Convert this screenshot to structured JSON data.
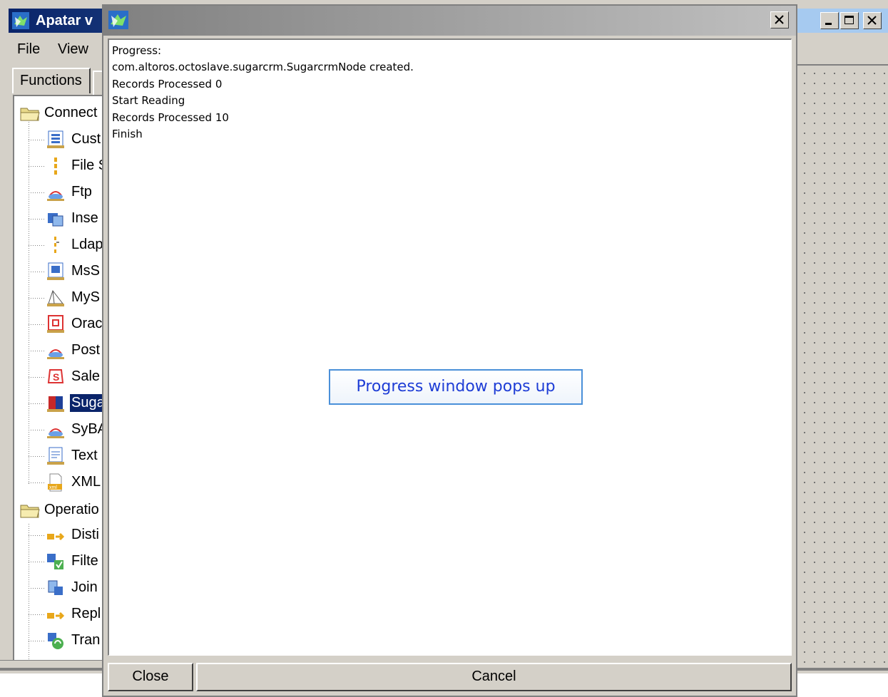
{
  "main_window": {
    "title": "Apatar v",
    "menu": [
      "File",
      "View"
    ],
    "tabs": [
      "Functions"
    ]
  },
  "tree": {
    "groups": [
      {
        "label": "Connect",
        "items": [
          {
            "label": "Cust",
            "icon": "custom-connector-icon"
          },
          {
            "label": "File S",
            "icon": "file-icon"
          },
          {
            "label": "Ftp",
            "icon": "ftp-icon"
          },
          {
            "label": "Inse",
            "icon": "insert-icon"
          },
          {
            "label": "Ldap",
            "icon": "ldap-icon"
          },
          {
            "label": "MsS",
            "icon": "mssql-icon"
          },
          {
            "label": "MyS",
            "icon": "mysql-icon"
          },
          {
            "label": "Orac",
            "icon": "oracle-icon"
          },
          {
            "label": "Post",
            "icon": "postgres-icon"
          },
          {
            "label": "Sale",
            "icon": "salesforce-icon"
          },
          {
            "label": "Suga",
            "icon": "sugarcrm-icon",
            "selected": true
          },
          {
            "label": "SyBA",
            "icon": "sybase-icon"
          },
          {
            "label": "Text",
            "icon": "text-file-icon"
          },
          {
            "label": "XML",
            "icon": "xml-icon"
          }
        ]
      },
      {
        "label": "Operatio",
        "items": [
          {
            "label": "Disti",
            "icon": "distinct-icon"
          },
          {
            "label": "Filte",
            "icon": "filter-icon"
          },
          {
            "label": "Join",
            "icon": "join-icon"
          },
          {
            "label": "Repl",
            "icon": "replace-icon"
          },
          {
            "label": "Tran",
            "icon": "transform-icon"
          }
        ]
      }
    ]
  },
  "dialog": {
    "log_lines": [
      "Progress:",
      "com.altoros.octoslave.sugarcrm.SugarcrmNode created.",
      "Records Processed 0",
      "Start Reading",
      "Records Processed 10",
      "Finish"
    ],
    "annotation": "Progress window pops up",
    "close_label": "Close",
    "cancel_label": "Cancel"
  },
  "colors": {
    "active_title": "#0a246a",
    "annotation_text": "#1e3dd6",
    "selection": "#0a246a",
    "face": "#d4d0c8"
  }
}
